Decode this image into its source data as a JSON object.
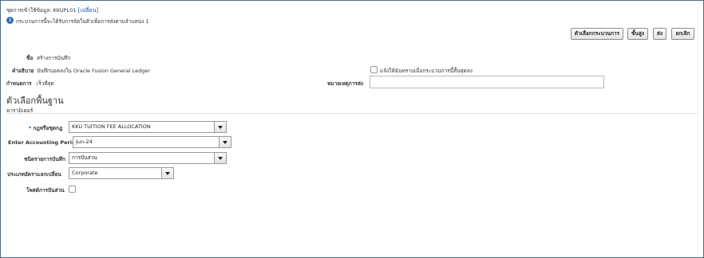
{
  "header": {
    "process_label": "ชุดการเข้าใช้ข้อมูล: KKUPL01",
    "change_link": "[เปลี่ยน]",
    "info_text": "กระบวนการนี้จะได้รับการจัดในคิวเพื่อการส่งตามลำแหน่ง 1"
  },
  "toolbar": {
    "process_options": "ตัวเลือกกระบวนการ",
    "advanced": "ขั้นสูง",
    "submit": "ส่ง",
    "cancel": "ยกเลิก"
  },
  "details": {
    "name_label": "ชื่อ",
    "name_value": "สร้างการบันทึก",
    "description_label": "คำอธิบาย",
    "description_value": "บันทึกบอดลงใน Oracle Fusion General Ledger",
    "schedule_label": "กำหนดการ",
    "schedule_value": "เร็วที่สุด",
    "notify_label": "แจ้งให้ฉันทราบเมื่อกระบวนการนี้สิ้นสุดลง",
    "submission_notes_label": "หมายเหตุการส่ง",
    "submission_notes_value": ""
  },
  "basic_options": {
    "title": "ตัวเลือกพื้นฐาน",
    "parameters_label": "พารามิเตอร์",
    "rule_set_label": "กฎหรือชุดกฎ",
    "rule_set_value": "KKU TUITION FEE ALLOCATION",
    "period_label": "Enter Accounting Period",
    "period_value": "Jun-24",
    "journal_category_label": "ชนิดรายการบันทึก",
    "journal_category_value": "การปันส่วน",
    "conversion_rate_label": "ประเภทอัตราแลกเปลี่ยน",
    "conversion_rate_value": "Corporate",
    "post_allocations_label": "โพสต์การปันส่วน"
  }
}
